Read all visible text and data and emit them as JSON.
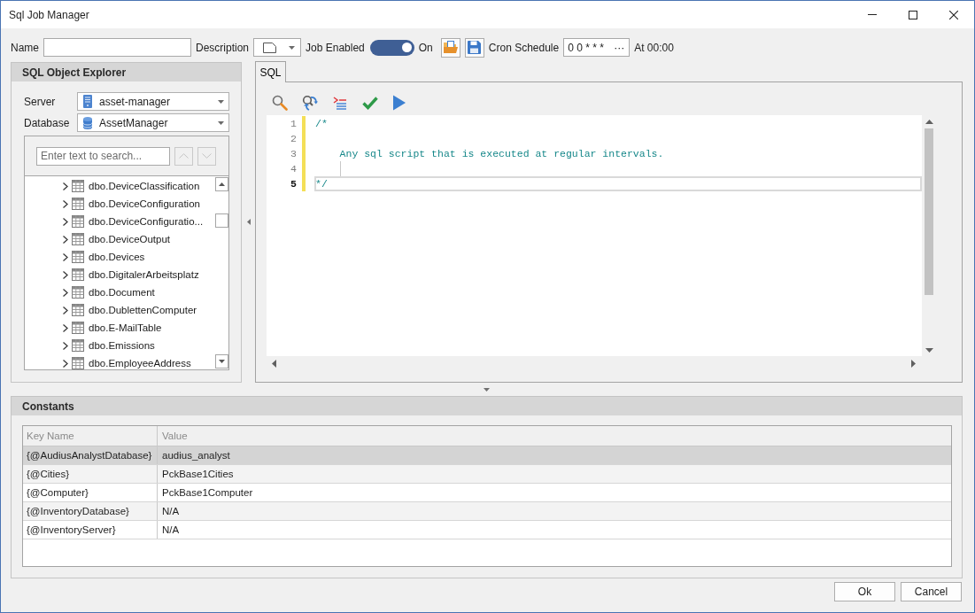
{
  "window": {
    "title": "Sql Job Manager"
  },
  "job_bar": {
    "name": {
      "label": "Name"
    },
    "description": {
      "label": "Description"
    },
    "job_enabled": {
      "label": "Job Enabled",
      "on": true,
      "state_label": "On"
    },
    "cron_schedule": {
      "label": "Cron Schedule",
      "value": "0 0 * * *",
      "button": "···",
      "summary": "At 00:00"
    }
  },
  "object_explorer": {
    "title": "SQL Object Explorer",
    "server": {
      "label": "Server",
      "value": "asset-manager"
    },
    "database": {
      "label": "Database",
      "value": "AssetManager"
    },
    "search": {
      "placeholder": "Enter text to search...",
      "navigation_disabled": true
    },
    "tree_items": [
      {
        "label": "dbo.DeviceClassification",
        "expanded": false
      },
      {
        "label": "dbo.DeviceConfiguration",
        "expanded": false
      },
      {
        "label": "dbo.DeviceConfiguratio...",
        "expanded": false
      },
      {
        "label": "dbo.DeviceOutput",
        "expanded": false
      },
      {
        "label": "dbo.Devices",
        "expanded": false
      },
      {
        "label": "dbo.DigitalerArbeitsplatz",
        "expanded": false
      },
      {
        "label": "dbo.Document",
        "expanded": false
      },
      {
        "label": "dbo.DublettenComputer",
        "expanded": false
      },
      {
        "label": "dbo.E-MailTable",
        "expanded": false
      },
      {
        "label": "dbo.Emissions",
        "expanded": false
      },
      {
        "label": "dbo.EmployeeAddress",
        "expanded": false
      }
    ]
  },
  "editor": {
    "tabs": [
      {
        "label": "SQL",
        "selected": true
      }
    ],
    "lines": [
      {
        "number": "1",
        "text": "/*",
        "modified": true,
        "current": false
      },
      {
        "number": "2",
        "modified": true,
        "current": false
      },
      {
        "number": "3",
        "text": "    Any sql script that is executed at regular intervals.",
        "modified": true,
        "current": false
      },
      {
        "number": "4",
        "modified": true,
        "current": false
      },
      {
        "number": "5",
        "text": "*/",
        "modified": true,
        "current": true
      }
    ]
  },
  "constants": {
    "title": "Constants",
    "columns": [
      "Key Name",
      "Value"
    ],
    "rows": [
      {
        "key": "{@AudiusAnalystDatabase}",
        "value": "audius_analyst",
        "selected": true
      },
      {
        "key": "{@Cities}",
        "value": "PckBase1Cities",
        "selected": false
      },
      {
        "key": "{@Computer}",
        "value": "PckBase1Computer",
        "selected": false
      },
      {
        "key": "{@InventoryDatabase}",
        "value": "N/A",
        "selected": false
      },
      {
        "key": "{@InventoryServer}",
        "value": "N/A",
        "selected": false
      }
    ]
  },
  "buttons": [
    "Ok",
    "Cancel"
  ]
}
